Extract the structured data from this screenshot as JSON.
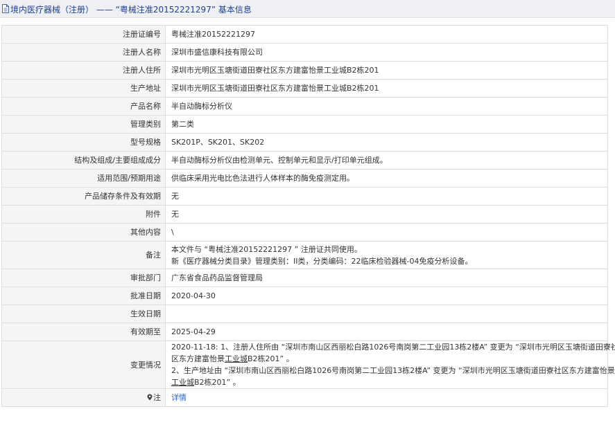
{
  "header": {
    "title": "境内医疗器械（注册） —— “粤械注准20152221297” 基本信息"
  },
  "fields": {
    "reg_no": {
      "label": "注册证编号",
      "value": "粤械注准20152221297"
    },
    "registrant": {
      "label": "注册人名称",
      "value": "深圳市盛信康科技有限公司"
    },
    "address": {
      "label": "注册人住所",
      "value": "深圳市光明区玉塘街道田寮社区东方建富怡景工业城B2栋201"
    },
    "production": {
      "label": "生产地址",
      "value": "深圳市光明区玉塘街道田寮社区东方建富怡景工业城B2栋201"
    },
    "product_name": {
      "label": "产品名称",
      "value": "半自动酶标分析仪"
    },
    "category": {
      "label": "管理类别",
      "value": "第二类"
    },
    "model": {
      "label": "型号规格",
      "value": "SK201P、SK201、SK202"
    },
    "structure": {
      "label": "结构及组成/主要组成成分",
      "value": "半自动酶标分析仪由检测单元、控制单元和显示/打印单元组成。"
    },
    "scope": {
      "label": "适用范围/预期用途",
      "value": "供临床采用光电比色法进行人体样本的酶免疫测定用。"
    },
    "storage": {
      "label": "产品储存条件及有效期",
      "value": "无"
    },
    "accessory": {
      "label": "附件",
      "value": "无"
    },
    "other": {
      "label": "其他内容",
      "value": "\\"
    },
    "remark": {
      "label": "备注",
      "line1": "本文件与 “粤械注准20152221297 ” 注册证共同使用。",
      "line2": "新《医疗器械分类目录》管理类别：II类，分类编码：22临床检验器械-04免疫分析设备。"
    },
    "approval_dept": {
      "label": "审批部门",
      "value": "广东省食品药品监督管理局"
    },
    "approval_date": {
      "label": "批准日期",
      "value": "2020-04-30"
    },
    "effective_date": {
      "label": "生效日期",
      "value": ""
    },
    "expiry": {
      "label": "有效期至",
      "value": "2025-04-29"
    },
    "changes": {
      "label": "变更情况",
      "line1": "2020-11-18: 1、注册人住所由 “深圳市南山区西丽松白路1026号南岗第二工业园13栋2楼A” 变更为 “深圳市光明区玉塘街道田寮社",
      "line2a": "区东方建富怡景",
      "line2b": "工业城",
      "line2c": "B2栋201” 。",
      "line3": "2、生产地址由 “深圳市南山区西丽松白路1026号南岗第二工业园13栋2楼A” 变更为 “深圳市光明区玉塘街道田寮社区东方建富怡景",
      "line4a": "工业城",
      "line4b": "B2栋201” 。"
    },
    "note": {
      "label": "注",
      "link": "详情"
    }
  },
  "colors": {
    "header_bg": "#eef0f4",
    "header_text": "#1f3f8f",
    "label_bg": "#f5f5f5",
    "border": "#dcdcdc",
    "link": "#2a62c9"
  }
}
